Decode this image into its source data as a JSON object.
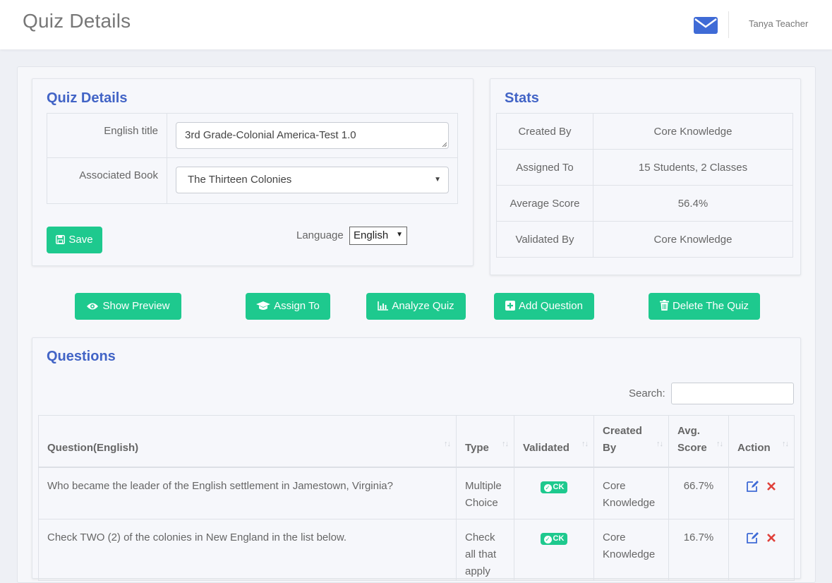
{
  "header": {
    "page_title": "Quiz Details",
    "user_name": "Tanya Teacher"
  },
  "quiz_details": {
    "title": "Quiz Details",
    "english_title_label": "English title",
    "english_title_value": "3rd Grade-Colonial America-Test 1.0",
    "associated_book_label": "Associated Book",
    "associated_book_value": "The Thirteen Colonies",
    "save_label": "Save",
    "language_label": "Language",
    "language_value": "English"
  },
  "stats": {
    "title": "Stats",
    "rows": [
      {
        "key": "Created By",
        "value": "Core Knowledge"
      },
      {
        "key": "Assigned To",
        "value": "15 Students, 2 Classes"
      },
      {
        "key": "Average Score",
        "value": "56.4%"
      },
      {
        "key": "Validated By",
        "value": "Core Knowledge"
      }
    ]
  },
  "actions": {
    "show_preview": "Show Preview",
    "assign_to": "Assign To",
    "analyze_quiz": "Analyze Quiz",
    "add_question": "Add Question",
    "delete_quiz": "Delete The Quiz"
  },
  "questions": {
    "title": "Questions",
    "search_label": "Search:",
    "search_value": "",
    "columns": {
      "question": "Question(English)",
      "type": "Type",
      "validated": "Validated",
      "created_by_1": "Created",
      "created_by_2": "By",
      "avg_score_1": "Avg.",
      "avg_score_2": "Score",
      "action": "Action"
    },
    "rows": [
      {
        "question": "Who became the leader of the English settlement in Jamestown, Virginia?",
        "type_1": "Multiple",
        "type_2": "Choice",
        "validated": "CK",
        "created_by_1": "Core",
        "created_by_2": "Knowledge",
        "avg_score": "66.7%"
      },
      {
        "question": "Check TWO (2) of the colonies in New England in the list below.",
        "type_1": "Check",
        "type_2": "all that",
        "type_3": "apply",
        "validated": "CK",
        "created_by_1": "Core",
        "created_by_2": "Knowledge",
        "avg_score": "16.7%"
      }
    ]
  },
  "colors": {
    "accent": "#4264c6",
    "button": "#1ec98e",
    "delete": "#e0403a",
    "edit": "#3f6bd6"
  }
}
